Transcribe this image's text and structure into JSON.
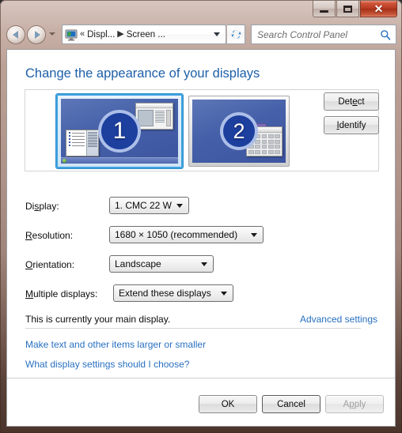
{
  "window": {
    "caption_buttons": {
      "minimize": "minimize-button",
      "maximize": "maximize-button",
      "close_glyph": "✕"
    }
  },
  "navbar": {
    "back_label": "Back",
    "forward_label": "Forward",
    "recent_pages_label": "Recent pages",
    "breadcrumb": {
      "icon": "display-monitor-icon",
      "leading_sep": "«",
      "crumb_1": "Displ...",
      "middle_sep": "▶",
      "crumb_2": "Screen ..."
    },
    "refresh_label": "Refresh",
    "search": {
      "placeholder": "Search Control Panel",
      "value": "",
      "icon": "search-icon"
    }
  },
  "page": {
    "heading": "Change the appearance of your displays"
  },
  "displays": [
    {
      "number": "1",
      "selected": true,
      "label": "Display 1 preview"
    },
    {
      "number": "2",
      "selected": false,
      "label": "Display 2 preview"
    }
  ],
  "preview_buttons": {
    "detect": {
      "pre": "Det",
      "key": "e",
      "post": "ct"
    },
    "identify": {
      "pre": "",
      "key": "I",
      "post": "dentify"
    }
  },
  "form": {
    "display": {
      "label_pre": "Di",
      "label_key": "s",
      "label_post": "play:",
      "value": "1. CMC 22 W"
    },
    "resolution": {
      "label_pre": "",
      "label_key": "R",
      "label_post": "esolution:",
      "value": "1680 × 1050 (recommended)"
    },
    "orientation": {
      "label_pre": "",
      "label_key": "O",
      "label_post": "rientation:",
      "value": "Landscape"
    },
    "multiple_displays": {
      "label_pre": "",
      "label_key": "M",
      "label_post": "ultiple displays:",
      "value": "Extend these displays"
    }
  },
  "status": {
    "main_display_text": "This is currently your main display.",
    "advanced_settings_link": "Advanced settings"
  },
  "links": {
    "larger_smaller": "Make text and other items larger or smaller",
    "what_settings": "What display settings should I choose?"
  },
  "footer": {
    "ok": "OK",
    "cancel": "Cancel",
    "apply": {
      "pre": "A",
      "key": "p",
      "post": "ply"
    }
  },
  "colors": {
    "frame": "#b0948a",
    "heading_blue": "#1d5fa8",
    "link_blue": "#2870c0",
    "selected_monitor_border": "#3ea3e0",
    "screen_blue": "#4560a8",
    "close_button_red": "#b63b22"
  }
}
